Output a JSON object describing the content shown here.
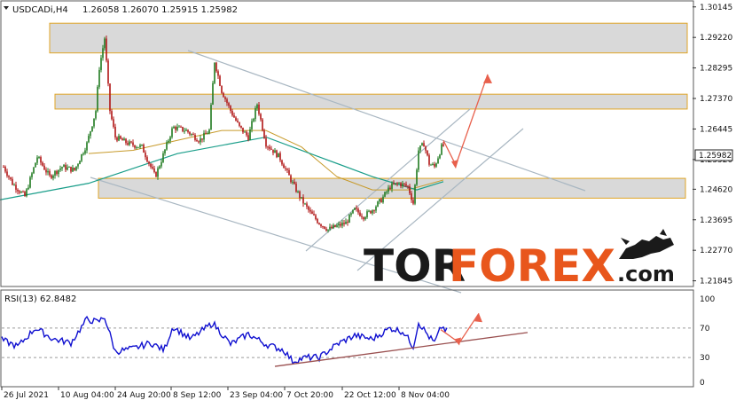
{
  "header": {
    "symbol": "USDCADi,H4",
    "ohlc": "1.26058 1.26070 1.25915 1.25982"
  },
  "rsi_header": "RSI(13) 62.8482",
  "logo": {
    "part1": "TOR",
    "part2": "FOREX",
    "part3": ".com"
  },
  "chart_data": [
    {
      "type": "candlestick",
      "price_axis": [
        "1.30145",
        "1.29220",
        "1.28295",
        "1.27370",
        "1.26445",
        "1.25520",
        "1.24620",
        "1.23695",
        "1.22770",
        "1.21845"
      ],
      "ylim": [
        1.217,
        1.303
      ],
      "current_price": "1.25982",
      "x_ticks": [
        "26 Jul 2021",
        "10 Aug 04:00",
        "24 Aug 20:00",
        "8 Sep 12:00",
        "23 Sep 04:00",
        "7 Oct 20:00",
        "22 Oct 12:00",
        "8 Nov 04:00"
      ],
      "price_path": [
        [
          0,
          1.255
        ],
        [
          14,
          1.248
        ],
        [
          28,
          1.244
        ],
        [
          42,
          1.256
        ],
        [
          56,
          1.25
        ],
        [
          70,
          1.253
        ],
        [
          84,
          1.252
        ],
        [
          98,
          1.26
        ],
        [
          108,
          1.27
        ],
        [
          112,
          1.283
        ],
        [
          118,
          1.292
        ],
        [
          124,
          1.27
        ],
        [
          130,
          1.262
        ],
        [
          145,
          1.26
        ],
        [
          160,
          1.259
        ],
        [
          175,
          1.25
        ],
        [
          182,
          1.255
        ],
        [
          195,
          1.265
        ],
        [
          210,
          1.264
        ],
        [
          225,
          1.261
        ],
        [
          236,
          1.264
        ],
        [
          242,
          1.285
        ],
        [
          250,
          1.276
        ],
        [
          260,
          1.27
        ],
        [
          270,
          1.265
        ],
        [
          280,
          1.262
        ],
        [
          290,
          1.272
        ],
        [
          300,
          1.26
        ],
        [
          315,
          1.256
        ],
        [
          330,
          1.248
        ],
        [
          340,
          1.243
        ],
        [
          350,
          1.239
        ],
        [
          360,
          1.236
        ],
        [
          370,
          1.234
        ],
        [
          380,
          1.235
        ],
        [
          390,
          1.236
        ],
        [
          400,
          1.24
        ],
        [
          410,
          1.238
        ],
        [
          420,
          1.24
        ],
        [
          430,
          1.243
        ],
        [
          440,
          1.247
        ],
        [
          450,
          1.248
        ],
        [
          460,
          1.247
        ],
        [
          466,
          1.242
        ],
        [
          472,
          1.258
        ],
        [
          478,
          1.26
        ],
        [
          484,
          1.254
        ],
        [
          490,
          1.253
        ],
        [
          498,
          1.259
        ],
        [
          504,
          1.26
        ]
      ],
      "resistance_zones": [
        {
          "low": 1.2875,
          "high": 1.2965
        },
        {
          "low": 1.2705,
          "high": 1.275
        },
        {
          "low": 1.2435,
          "high": 1.2495
        }
      ],
      "ma_fast": [
        [
          100,
          1.257
        ],
        [
          150,
          1.258
        ],
        [
          200,
          1.261
        ],
        [
          250,
          1.264
        ],
        [
          300,
          1.264
        ],
        [
          340,
          1.259
        ],
        [
          380,
          1.25
        ],
        [
          420,
          1.246
        ],
        [
          460,
          1.246
        ],
        [
          500,
          1.249
        ]
      ],
      "ma_slow": [
        [
          0,
          1.243
        ],
        [
          100,
          1.248
        ],
        [
          200,
          1.257
        ],
        [
          300,
          1.262
        ],
        [
          360,
          1.256
        ],
        [
          420,
          1.25
        ],
        [
          470,
          1.246
        ],
        [
          500,
          1.2485
        ]
      ],
      "projection": [
        [
          500,
          1.261
        ],
        [
          514,
          1.2535
        ],
        [
          550,
          1.281
        ]
      ]
    },
    {
      "type": "line",
      "name": "RSI(13)",
      "ylim": [
        0,
        100
      ],
      "levels": [
        "100",
        "70",
        "30",
        "0"
      ],
      "value": 62.8482,
      "rsi_path": [
        [
          0,
          55
        ],
        [
          20,
          45
        ],
        [
          40,
          70
        ],
        [
          60,
          55
        ],
        [
          80,
          50
        ],
        [
          98,
          82
        ],
        [
          110,
          78
        ],
        [
          118,
          85
        ],
        [
          130,
          38
        ],
        [
          150,
          42
        ],
        [
          170,
          50
        ],
        [
          185,
          40
        ],
        [
          195,
          72
        ],
        [
          215,
          55
        ],
        [
          240,
          77
        ],
        [
          260,
          48
        ],
        [
          280,
          62
        ],
        [
          300,
          48
        ],
        [
          320,
          40
        ],
        [
          330,
          25
        ],
        [
          345,
          30
        ],
        [
          360,
          30
        ],
        [
          380,
          48
        ],
        [
          400,
          60
        ],
        [
          420,
          55
        ],
        [
          440,
          70
        ],
        [
          455,
          65
        ],
        [
          466,
          45
        ],
        [
          472,
          78
        ],
        [
          484,
          58
        ],
        [
          490,
          50
        ],
        [
          498,
          72
        ],
        [
          504,
          66
        ]
      ],
      "trend_line": [
        [
          310,
          18
        ],
        [
          595,
          64
        ]
      ],
      "projection": [
        [
          497,
          68
        ],
        [
          518,
          50
        ],
        [
          540,
          90
        ]
      ]
    }
  ]
}
